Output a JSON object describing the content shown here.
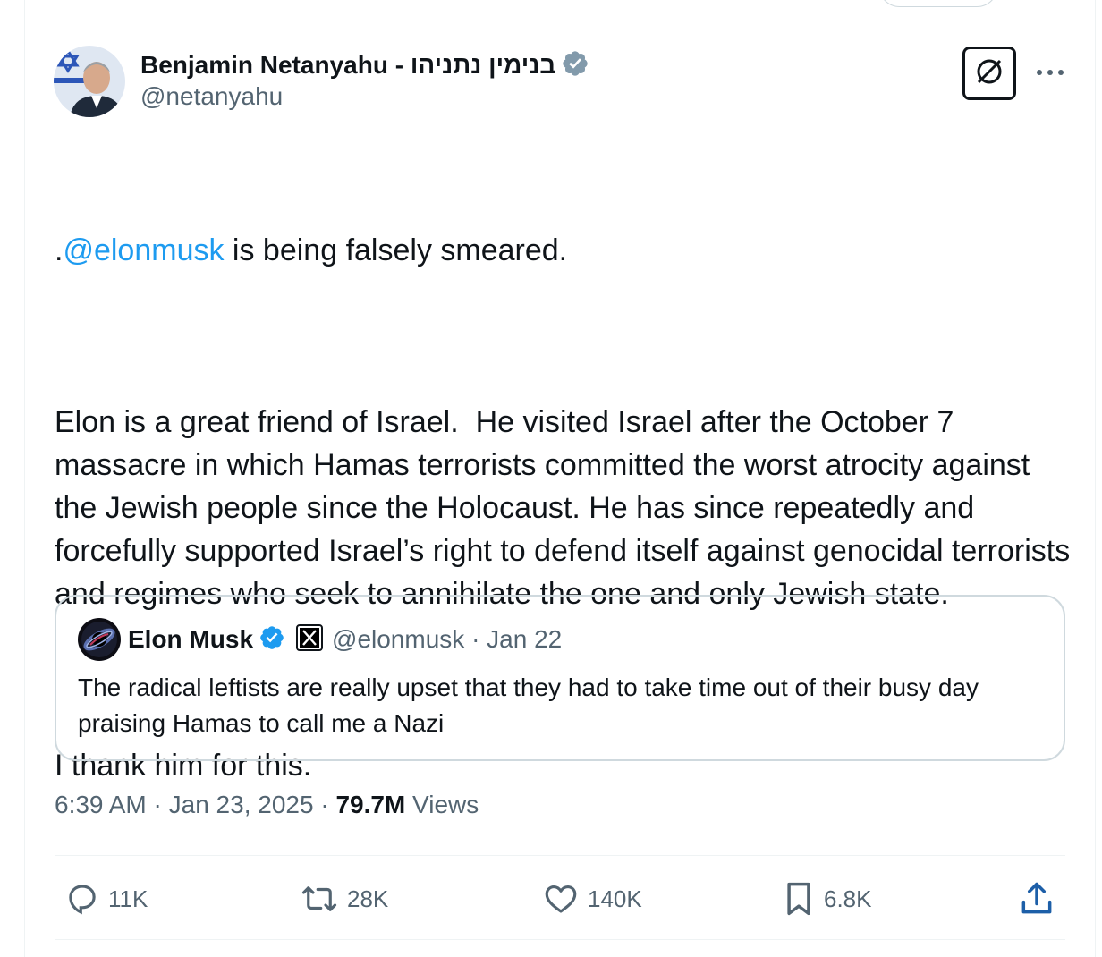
{
  "tweet": {
    "author": {
      "display_name": "Benjamin Netanyahu - בנימין נתניהו",
      "handle": "@netanyahu",
      "verified_icon": "verified-badge-icon"
    },
    "body": {
      "paragraph1_prefix": ".",
      "paragraph1_mention": "@elonmusk",
      "paragraph1_rest": " is being falsely smeared.",
      "paragraph2": "Elon is a great friend of Israel.  He visited Israel after the October 7 massacre in which Hamas terrorists committed the worst atrocity against the Jewish people since the Holocaust. He has since repeatedly and forcefully supported Israel’s right to defend itself against genocidal terrorists and regimes who seek to annihilate the one and only Jewish state.",
      "paragraph3": "I thank him for this."
    },
    "quoted": {
      "display_name": "Elon Musk",
      "handle": "@elonmusk",
      "separator": "·",
      "date": "Jan 22",
      "text": "The radical leftists are really upset that they had to take time out of their busy day praising Hamas to call me a Nazi"
    },
    "meta": {
      "time": "6:39 AM",
      "separator": "·",
      "date": "Jan 23, 2025",
      "views_count": "79.7M",
      "views_label": "Views"
    },
    "actions": {
      "replies": "11K",
      "reposts": "28K",
      "likes": "140K",
      "bookmarks": "6.8K"
    }
  },
  "colors": {
    "accent": "#1d9bf0",
    "text": "#0f1419",
    "secondary": "#536471",
    "border": "#cfd9de"
  },
  "icons": [
    "verified-badge-icon",
    "grok-icon",
    "more-icon",
    "x-logo-icon",
    "reply-icon",
    "repost-icon",
    "like-icon",
    "bookmark-icon",
    "share-icon"
  ]
}
